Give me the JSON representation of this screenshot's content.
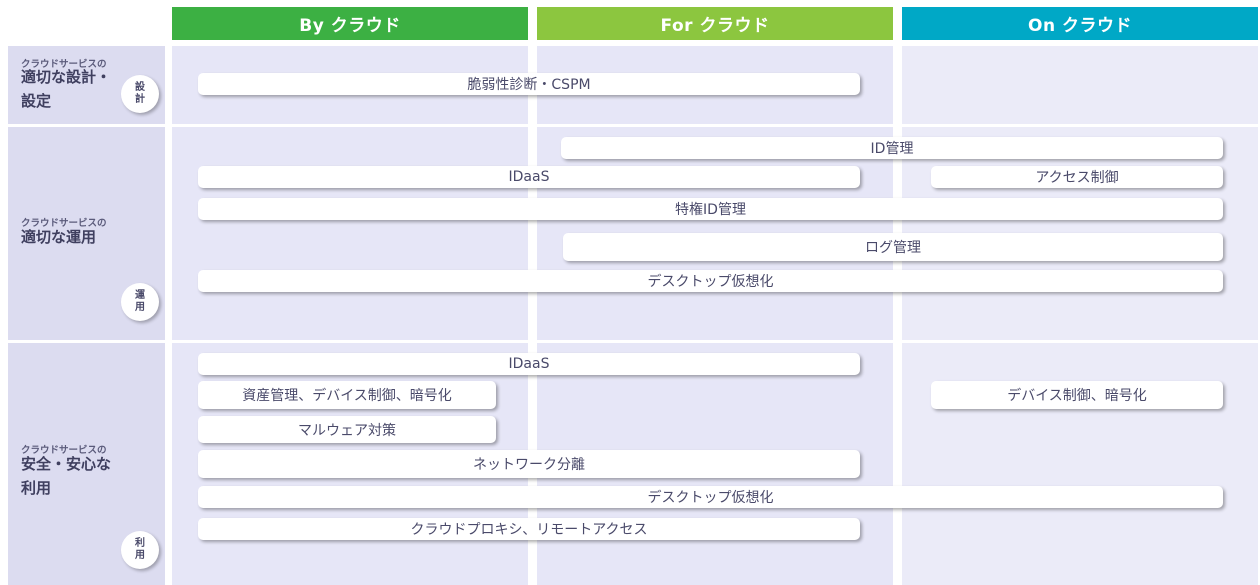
{
  "columns": {
    "by": {
      "label": "By クラウド",
      "color": "#3cb043"
    },
    "for": {
      "label": "For クラウド",
      "color": "#8cc63f"
    },
    "on": {
      "label": "On クラウド",
      "color": "#00a8c6"
    }
  },
  "rows": {
    "design": {
      "small": "クラウドサービスの",
      "big_line1": "適切な設計・",
      "big_line2": "設定",
      "badge_line1": "設",
      "badge_line2": "計"
    },
    "ops": {
      "small": "クラウドサービスの",
      "big_line1": "適切な運用",
      "badge_line1": "運",
      "badge_line2": "用"
    },
    "use": {
      "small": "クラウドサービスの",
      "big_line1": "安全・安心な",
      "big_line2": "利用",
      "badge_line1": "利",
      "badge_line2": "用"
    }
  },
  "bars": {
    "vuln": "脆弱性診断・CSPM",
    "id_mgmt": "ID管理",
    "idaas_ops": "IDaaS",
    "access_ctrl": "アクセス制御",
    "priv_id": "特権ID管理",
    "log_mgmt": "ログ管理",
    "vdi_ops": "デスクトップ仮想化",
    "idaas_use": "IDaaS",
    "asset": "資産管理、デバイス制御、暗号化",
    "device": "デバイス制御、暗号化",
    "malware": "マルウェア対策",
    "network": "ネットワーク分離",
    "vdi_use": "デスクトップ仮想化",
    "proxy": "クラウドプロキシ、リモートアクセス"
  }
}
